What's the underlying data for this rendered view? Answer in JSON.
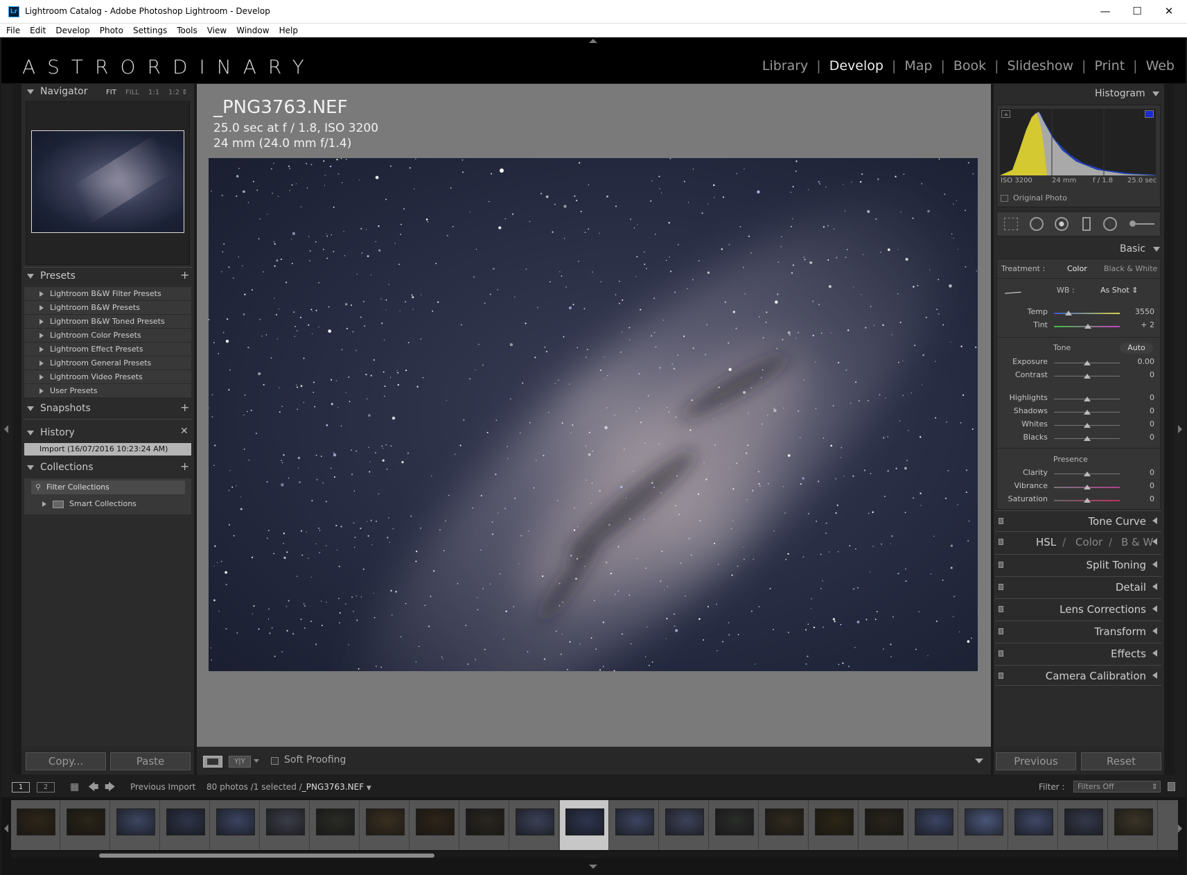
{
  "window": {
    "title": "Lightroom Catalog - Adobe Photoshop Lightroom - Develop",
    "icon_text": "Lr",
    "minimize": "—",
    "maximize": "☐",
    "close": "✕"
  },
  "menu": [
    "File",
    "Edit",
    "Develop",
    "Photo",
    "Settings",
    "Tools",
    "View",
    "Window",
    "Help"
  ],
  "brand": "ASTRORDINARY",
  "modules": [
    {
      "label": "Library"
    },
    {
      "label": "Develop",
      "active": true
    },
    {
      "label": "Map"
    },
    {
      "label": "Book"
    },
    {
      "label": "Slideshow"
    },
    {
      "label": "Print"
    },
    {
      "label": "Web"
    }
  ],
  "left": {
    "navigator": {
      "title": "Navigator",
      "fit": "FIT",
      "fill": "FILL",
      "one": "1:1",
      "zoom": "1:2"
    },
    "presets": {
      "title": "Presets",
      "items": [
        "Lightroom B&W Filter Presets",
        "Lightroom B&W Presets",
        "Lightroom B&W Toned Presets",
        "Lightroom Color Presets",
        "Lightroom Effect Presets",
        "Lightroom General Presets",
        "Lightroom Video Presets",
        "User Presets"
      ]
    },
    "snapshots": {
      "title": "Snapshots"
    },
    "history": {
      "title": "History",
      "items": [
        "Import (16/07/2016 10:23:24 AM)"
      ]
    },
    "collections": {
      "title": "Collections",
      "filter": "Filter Collections",
      "smart": "Smart Collections"
    },
    "copy": "Copy...",
    "paste": "Paste"
  },
  "photo": {
    "filename": "_PNG3763.NEF",
    "exposure": "25.0 sec at f / 1.8, ISO 3200",
    "lens": "24 mm (24.0 mm f/1.4)"
  },
  "toolbar": {
    "soft_proofing": "Soft Proofing",
    "yy": "Y|Y"
  },
  "right": {
    "histogram": {
      "title": "Histogram",
      "iso": "ISO 3200",
      "focal": "24 mm",
      "aperture": "f / 1.8",
      "shutter": "25.0 sec",
      "original_photo": "Original Photo"
    },
    "basic": {
      "title": "Basic",
      "treatment_label": "Treatment :",
      "color": "Color",
      "bw": "Black & White",
      "wb_label": "WB :",
      "wb_value": "As Shot",
      "tone_label": "Tone",
      "auto": "Auto",
      "presence_label": "Presence",
      "wb_sliders": [
        {
          "label": "Temp",
          "value": "3550",
          "pos": 0.22
        },
        {
          "label": "Tint",
          "value": "+ 2",
          "pos": 0.52
        }
      ],
      "tone_sliders": [
        {
          "label": "Exposure",
          "value": "0.00",
          "pos": 0.5
        },
        {
          "label": "Contrast",
          "value": "0",
          "pos": 0.5
        }
      ],
      "tone_sliders2": [
        {
          "label": "Highlights",
          "value": "0",
          "pos": 0.5
        },
        {
          "label": "Shadows",
          "value": "0",
          "pos": 0.5
        },
        {
          "label": "Whites",
          "value": "0",
          "pos": 0.5
        },
        {
          "label": "Blacks",
          "value": "0",
          "pos": 0.5
        }
      ],
      "presence_sliders": [
        {
          "label": "Clarity",
          "value": "0",
          "pos": 0.5
        },
        {
          "label": "Vibrance",
          "value": "0",
          "pos": 0.5
        },
        {
          "label": "Saturation",
          "value": "0",
          "pos": 0.5
        }
      ]
    },
    "panels": [
      "Tone Curve",
      "HSL",
      "Split Toning",
      "Detail",
      "Lens Corrections",
      "Transform",
      "Effects",
      "Camera Calibration"
    ],
    "hsl_parts": {
      "hsl": "HSL",
      "slash": "/",
      "color": "Color",
      "bw": "B & W"
    },
    "previous": "Previous",
    "reset": "Reset"
  },
  "filmstrip": {
    "page1": "1",
    "page2": "2",
    "source": "Previous Import",
    "count": "80 photos /1 selected /",
    "selected_file": "_PNG3763.NEF",
    "filter_label": "Filter :",
    "filter_value": "Filters Off",
    "thumb_colors": [
      "#2e2518",
      "#2a2418",
      "#3c4560",
      "#2e3448",
      "#3a4360",
      "#3a3c48",
      "#2a2a26",
      "#3a2f20",
      "#2e2418",
      "#2a2620",
      "#3a4058",
      "#2e3550",
      "#3c4460",
      "#3c4258",
      "#2a2c2a",
      "#302a1e",
      "#2c2616",
      "#28241c",
      "#3a4462",
      "#4a5578",
      "#3e4766",
      "#34384a",
      "#3a3426"
    ]
  }
}
